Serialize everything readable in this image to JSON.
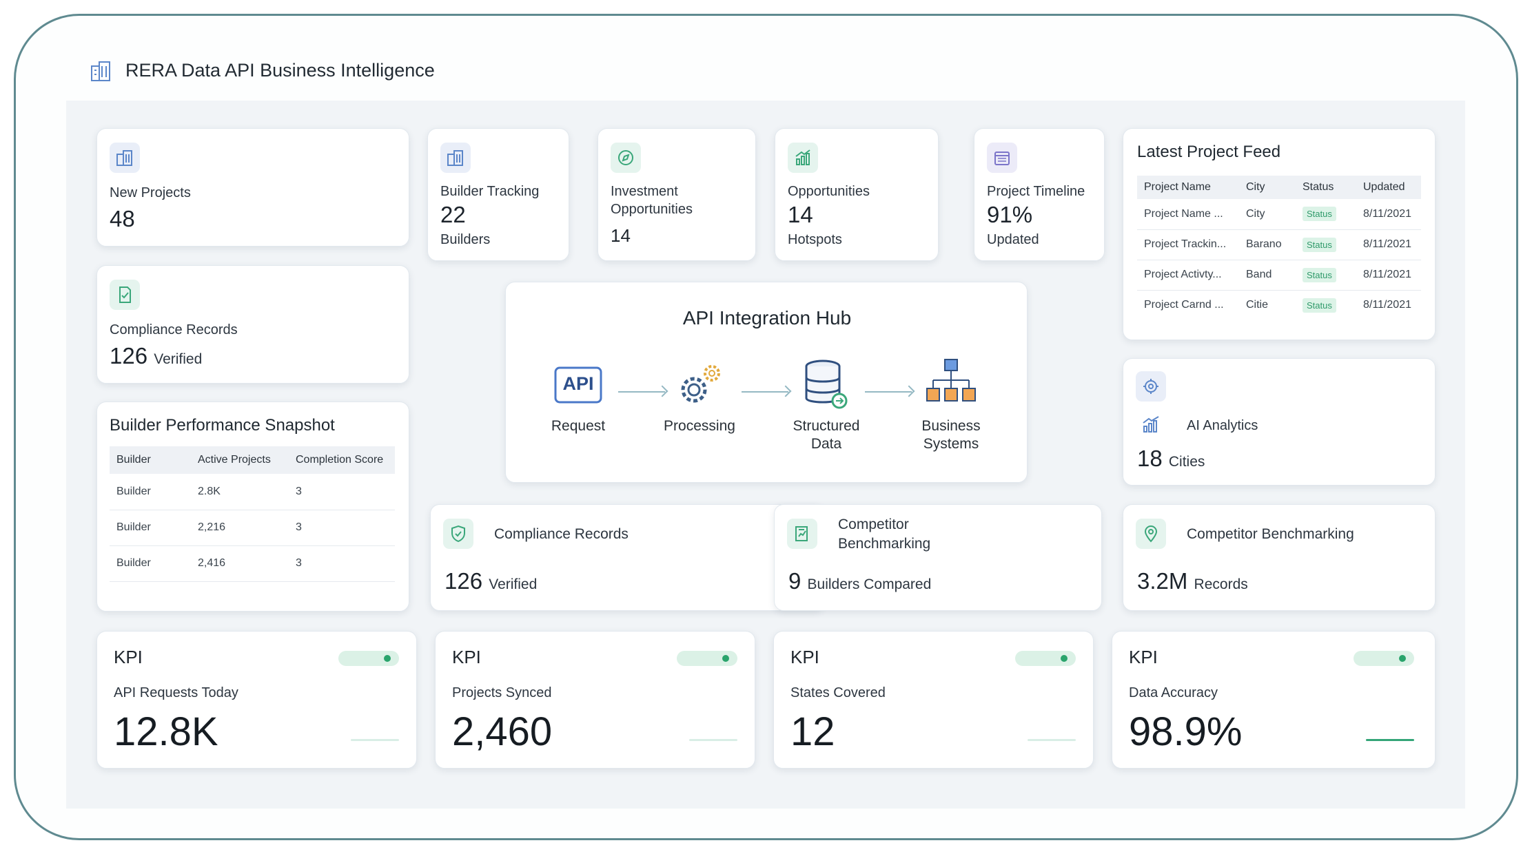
{
  "header": {
    "title": "RERA Data API Business Intelligence"
  },
  "stats": {
    "new_projects": {
      "label": "New Projects",
      "value": "48"
    },
    "builder_tracking": {
      "label": "Builder Tracking",
      "value": "22",
      "unit": "Builders"
    },
    "investment": {
      "label_line1": "Investment",
      "label_line2": "Opportunities",
      "value": "14"
    },
    "opportunities": {
      "label": "Opportunities",
      "value": "14",
      "unit": "Hotspots"
    },
    "project_timeline": {
      "label": "Project Timeline",
      "value": "91%",
      "unit": "Updated"
    },
    "compliance_left": {
      "label": "Compliance Records",
      "value": "126",
      "unit": "Verified"
    }
  },
  "builder_snapshot": {
    "title": "Builder Performance Snapshot",
    "columns": [
      "Builder",
      "Active Projects",
      "Completion Score"
    ],
    "rows": [
      [
        "Builder",
        "2.8K",
        "3"
      ],
      [
        "Builder",
        "2,216",
        "3"
      ],
      [
        "Builder",
        "2,416",
        "3"
      ]
    ]
  },
  "feed": {
    "title": "Latest Project Feed",
    "columns": [
      "Project Name",
      "City",
      "Status",
      "Updated"
    ],
    "rows": [
      [
        "Project Name ...",
        "City",
        "Status",
        "8/11/2021"
      ],
      [
        "Project Trackin...",
        "Barano",
        "Status",
        "8/11/2021"
      ],
      [
        "Project Activty...",
        "Band",
        "Status",
        "8/11/2021"
      ],
      [
        "Project Carnd ...",
        "Citie",
        "Status",
        "8/11/2021"
      ]
    ]
  },
  "hub": {
    "title": "API Integration Hub",
    "api_badge": "API",
    "steps": [
      {
        "line1": "Request",
        "line2": ""
      },
      {
        "line1": "Processing",
        "line2": ""
      },
      {
        "line1": "Structured",
        "line2": "Data"
      },
      {
        "line1": "Business",
        "line2": "Systems"
      }
    ]
  },
  "ai": {
    "label": "AI Analytics",
    "value": "18",
    "unit": "Cities"
  },
  "mid_row": {
    "compliance": {
      "label": "Compliance Records",
      "value": "126",
      "unit": "Verified"
    },
    "competitor": {
      "label_line1": "Competitor",
      "label_line2": "Benchmarking",
      "value": "9",
      "unit": "Builders Compared"
    },
    "benchmark": {
      "label": "Competitor Benchmarking",
      "value": "3.2M",
      "unit": "Records"
    }
  },
  "kpis": [
    {
      "tag": "KPI",
      "label": "API Requests Today",
      "value": "12.8K"
    },
    {
      "tag": "KPI",
      "label": "Projects Synced",
      "value": "2,460"
    },
    {
      "tag": "KPI",
      "label": "States Covered",
      "value": "12"
    },
    {
      "tag": "KPI",
      "label": "Data Accuracy",
      "value": "98.9%"
    }
  ],
  "colors": {
    "frame": "#5f8a90",
    "accent_green": "#2aa46c",
    "icon_blue": "#4a78c8",
    "background": "#f1f4f7"
  }
}
